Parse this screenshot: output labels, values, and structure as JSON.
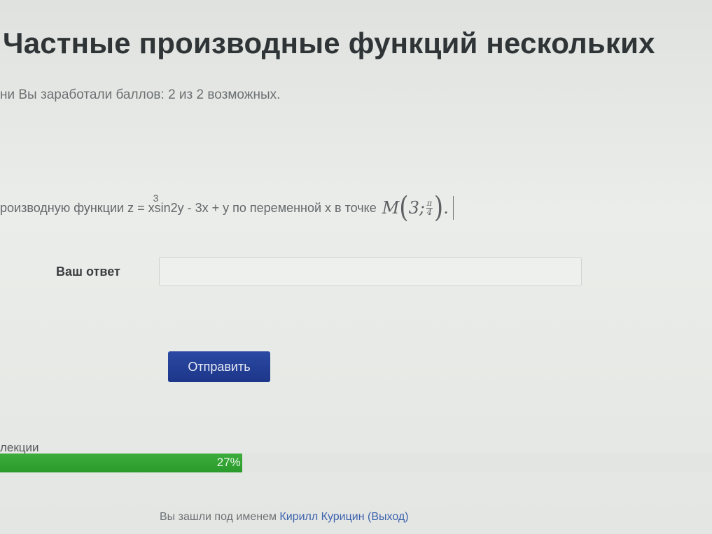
{
  "page": {
    "title": "Частные производные функций нескольких",
    "score_text": "ни Вы заработали баллов: 2 из 2 возможных."
  },
  "question": {
    "prefix": "роизводную функции z = x",
    "exponent": "3",
    "suffix": " sin2y - 3x + y по переменной x в точке",
    "point_letter": "M",
    "point_x": "3;",
    "frac_num": "π",
    "frac_den": "4",
    "point_end": "."
  },
  "answer": {
    "label": "Ваш ответ",
    "value": "",
    "placeholder": ""
  },
  "submit": {
    "label": "Отправить"
  },
  "progress": {
    "label": "лекции",
    "text": "27%",
    "percent": 34
  },
  "footer": {
    "logged_in_prefix": "Вы зашли под именем",
    "user_name": "Кирилл Курицин",
    "logout_label": "(Выход)"
  }
}
